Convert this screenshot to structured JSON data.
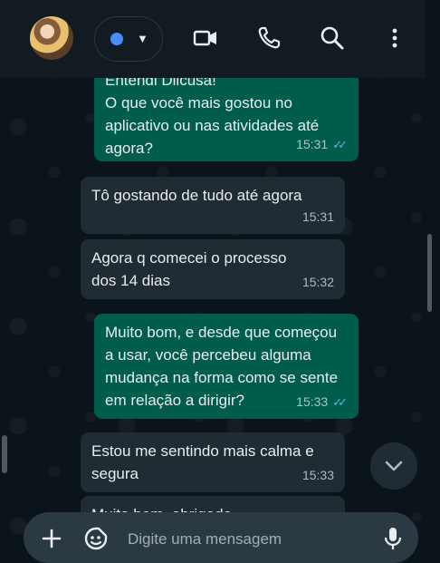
{
  "header": {
    "avatar_alt": "contact photo",
    "status_color": "#4a8df6"
  },
  "messages": [
    {
      "direction": "out",
      "text": "Entendi Dilcusa!\nO que você mais gostou no aplicativo ou nas atividades até agora?",
      "time": "15:31",
      "read": true
    },
    {
      "direction": "in",
      "text": "Tô gostando de tudo até agora",
      "time": "15:31"
    },
    {
      "direction": "in",
      "text": "Agora q comecei o processo dos 14 dias",
      "time": "15:32"
    },
    {
      "direction": "out",
      "text": "Muito bom, e desde que começou a usar, você percebeu alguma mudança na forma como se sente em relação a dirigir?",
      "time": "15:33",
      "read": true
    },
    {
      "direction": "in",
      "text": "Estou me sentindo mais calma e segura",
      "time": "15:33"
    },
    {
      "direction": "in",
      "text": "Muito bem, obrigado",
      "time": ""
    }
  ],
  "input": {
    "placeholder": "Digite uma mensagem"
  },
  "colors": {
    "outgoing_bubble": "#005c4b",
    "incoming_bubble": "#202c33",
    "read_ticks": "#53bdeb"
  }
}
